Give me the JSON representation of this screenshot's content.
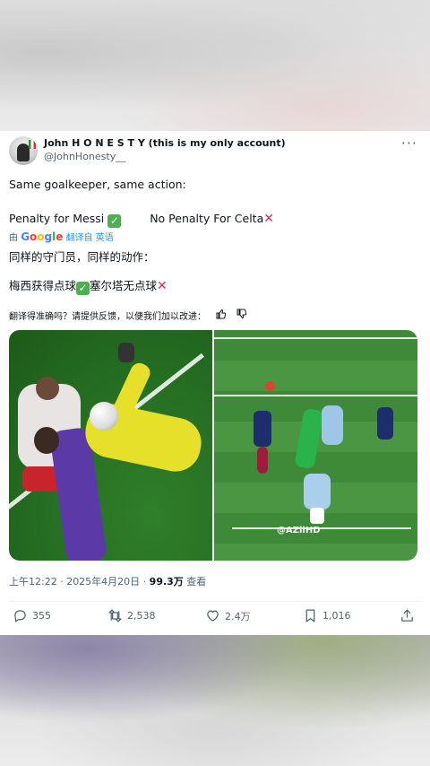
{
  "tweet": {
    "display_name": "John H O N E S T Y (this is my only account)",
    "handle": "@JohnHonesty__",
    "more_label": "···",
    "line1": "Same goalkeeper, same action:",
    "line2_a": "Penalty for Messi",
    "line2_b": "No Penalty For Celta",
    "check_glyph": "✓",
    "cross_glyph": "✕",
    "translated_by_prefix": "由",
    "google_label": "Google",
    "translated_by_suffix": "翻译自 英语",
    "translated_line1": "同样的守门员，同样的动作：",
    "translated_line2_a": "梅西获得点球",
    "translated_line2_b": "塞尔塔无点球",
    "feedback_prompt": "翻译得准确吗？请提供反馈，以便我们加以改进：",
    "media_watermark": "@AZiiHD",
    "timestamp_text": "上午12:22 · 2025年4月20日 · ",
    "views_count": "99.3万",
    "views_label": " 查看",
    "actions": {
      "replies": "355",
      "retweets": "2,538",
      "likes": "2.4万",
      "bookmarks": "1,016"
    },
    "colors": {
      "link": "#1d9bf0",
      "check": "#4caf50",
      "cross": "#e0245e",
      "muted": "#536471"
    }
  }
}
